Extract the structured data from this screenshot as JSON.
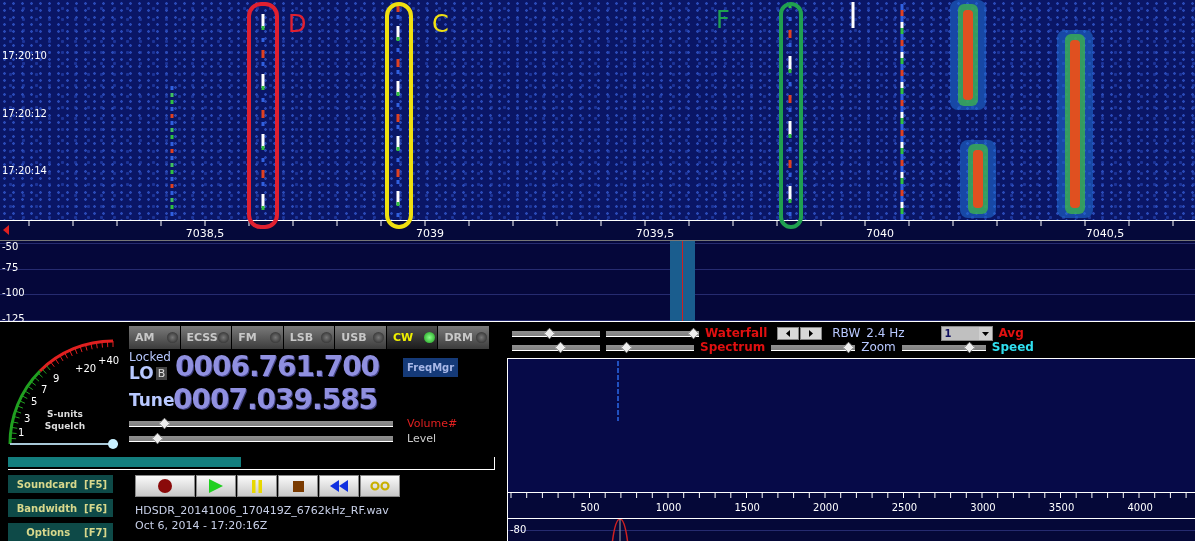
{
  "waterfall": {
    "time_labels": [
      "17:20:10",
      "17:20:12",
      "17:20:14"
    ],
    "annotations": [
      {
        "label": "D",
        "color": "#e02030"
      },
      {
        "label": "C",
        "color": "#f0e010"
      },
      {
        "label": "F",
        "color": "#20a050"
      }
    ]
  },
  "frequency_axis": {
    "labels": [
      "7038,5",
      "7039",
      "7039,5",
      "7040",
      "7040,5"
    ]
  },
  "spectrum": {
    "db_labels": [
      "-50",
      "-75",
      "-100",
      "-125"
    ]
  },
  "s_meter": {
    "scale_labels": [
      "1",
      "3",
      "5",
      "7",
      "9",
      "+20",
      "+40"
    ],
    "units_label": "S-units",
    "squelch_label": "Squelch",
    "squelch": {
      "level": 1.0
    }
  },
  "modes": [
    {
      "label": "AM",
      "selected": false
    },
    {
      "label": "ECSS",
      "selected": false
    },
    {
      "label": "FM",
      "selected": false
    },
    {
      "label": "LSB",
      "selected": false
    },
    {
      "label": "USB",
      "selected": false
    },
    {
      "label": "CW",
      "selected": true
    },
    {
      "label": "DRM",
      "selected": false
    }
  ],
  "lo": {
    "status": "Locked",
    "label": "LO",
    "bank": "B",
    "frequency": "0006.761.700"
  },
  "tune": {
    "label": "Tune",
    "frequency": "0007.039.585"
  },
  "freqmgr_button": "FreqMgr",
  "sliders": [
    {
      "label": "Volume#",
      "level": 0.12
    },
    {
      "label": "Level",
      "level": 0.09
    }
  ],
  "progress": {
    "level": 0.48
  },
  "side_buttons": [
    "Soundcard  [F5]",
    "Bandwidth  [F6]",
    "Options    [F7]"
  ],
  "recording": {
    "filename": "HDSDR_20141006_170419Z_6762kHz_RF.wav",
    "timestamp": "Oct 6, 2014 - 17:20:16Z"
  },
  "audio_controls": {
    "waterfall_row": {
      "label": "Waterfall",
      "sliders": [
        {
          "level": 0.42
        },
        {
          "level": 1.0
        }
      ]
    },
    "rbw_label": "RBW",
    "rbw_value": "2.4 Hz",
    "avg_select": "1",
    "avg_label": "Avg",
    "spectrum_row": {
      "label": "Spectrum",
      "sliders": [
        {
          "level": 0.56
        },
        {
          "level": 0.2
        }
      ]
    },
    "zoom": {
      "label": "Zoom",
      "level": 0.99
    },
    "speed": {
      "label": "Speed",
      "level": 0.85
    }
  },
  "audio_axis": {
    "labels": [
      "500",
      "1000",
      "1500",
      "2000",
      "2500",
      "3000",
      "3500",
      "4000"
    ]
  },
  "audio_spectrum": {
    "db_labels": [
      "-80"
    ]
  }
}
